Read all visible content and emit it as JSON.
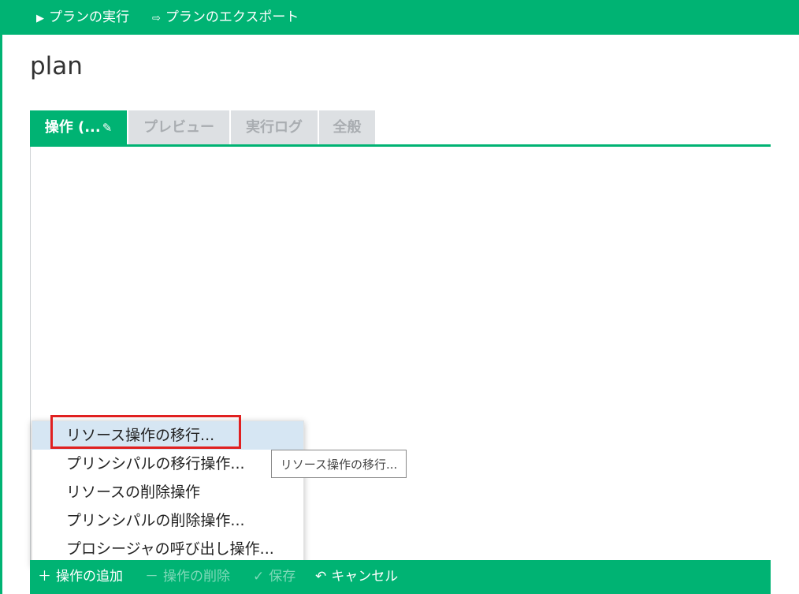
{
  "colors": {
    "accent": "#00b373",
    "highlight_box": "#e02020",
    "menu_hover": "#d6e6f3"
  },
  "toolbar": {
    "run": {
      "label": "プランの実行",
      "icon": "play-icon"
    },
    "export": {
      "label": "プランのエクスポート",
      "icon": "export-icon"
    }
  },
  "page": {
    "title": "plan"
  },
  "tabs": [
    {
      "label": "操作 (...",
      "icon": "pencil-icon",
      "active": true
    },
    {
      "label": "プレビュー",
      "active": false
    },
    {
      "label": "実行ログ",
      "active": false
    },
    {
      "label": "全般",
      "active": false
    }
  ],
  "menu": {
    "items": [
      {
        "label": "リソース操作の移行...",
        "highlighted": true
      },
      {
        "label": "プリンシパルの移行操作...",
        "highlighted": false
      },
      {
        "label": "リソースの削除操作",
        "highlighted": false
      },
      {
        "label": "プリンシパルの削除操作...",
        "highlighted": false
      },
      {
        "label": "プロシージャの呼び出し操作...",
        "highlighted": false
      }
    ]
  },
  "tooltip": {
    "text": "リソース操作の移行..."
  },
  "bottombar": {
    "add": {
      "label": "操作の追加",
      "icon": "plus-icon",
      "enabled": true
    },
    "delete": {
      "label": "操作の削除",
      "icon": "minus-icon",
      "enabled": false
    },
    "save": {
      "label": "保存",
      "icon": "check-icon",
      "enabled": false
    },
    "cancel": {
      "label": "キャンセル",
      "icon": "undo-icon",
      "enabled": true
    }
  }
}
